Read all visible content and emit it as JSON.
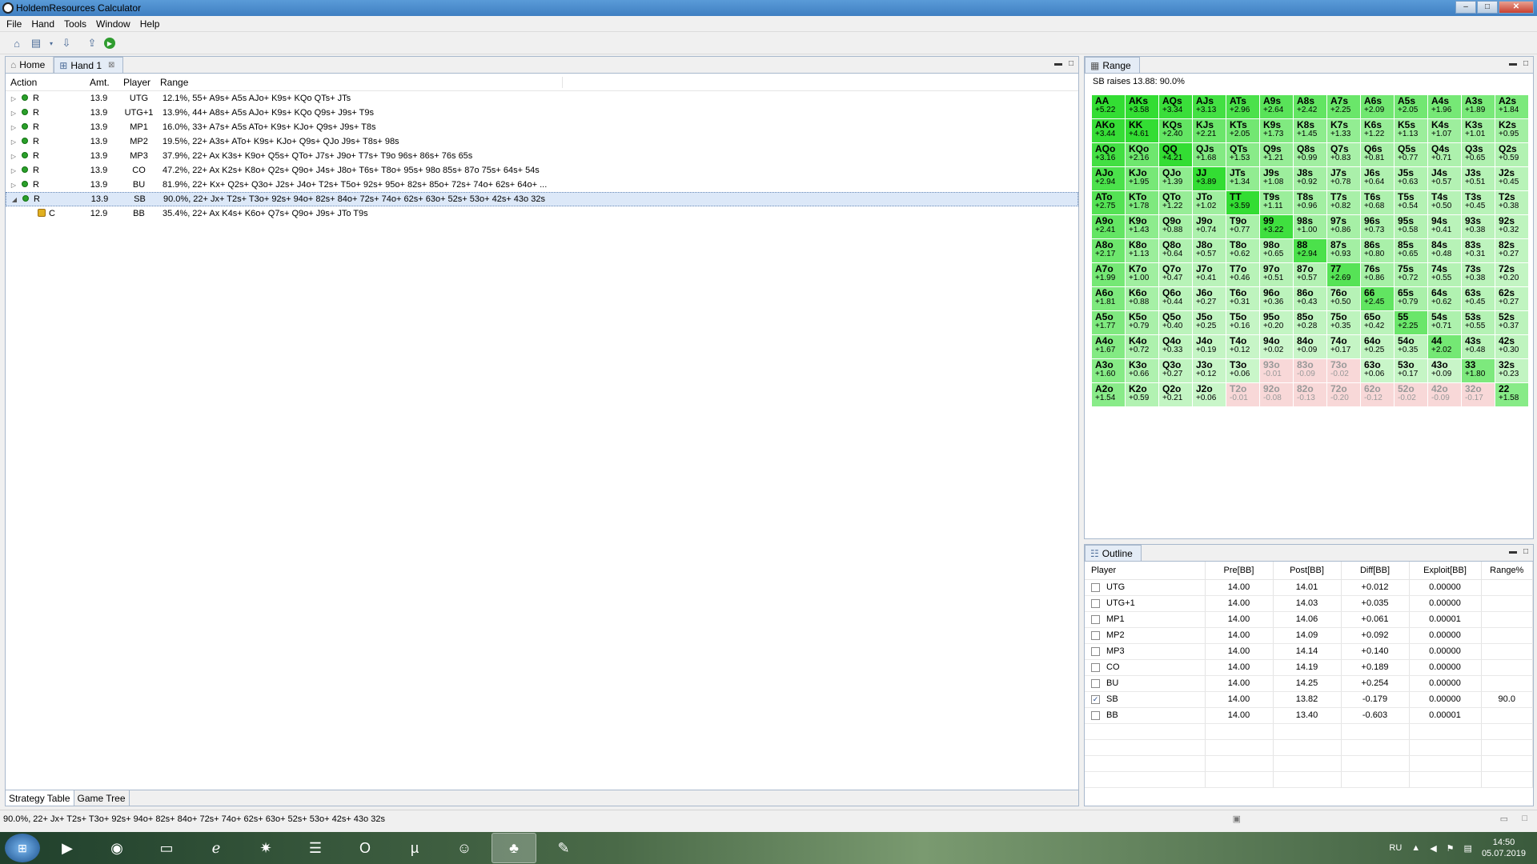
{
  "window": {
    "title": "HoldemResources Calculator"
  },
  "menu": [
    "File",
    "Hand",
    "Tools",
    "Window",
    "Help"
  ],
  "tabs": {
    "home": "Home",
    "hand": "Hand 1"
  },
  "strategy": {
    "headers": {
      "action": "Action",
      "amt": "Amt.",
      "player": "Player",
      "range": "Range"
    },
    "rows": [
      {
        "action": "R",
        "amt": "13.9",
        "player": "UTG",
        "range": "12.1%, 55+ A9s+ A5s AJo+ K9s+ KQo QTs+ JTs"
      },
      {
        "action": "R",
        "amt": "13.9",
        "player": "UTG+1",
        "range": "13.9%, 44+ A8s+ A5s AJo+ K9s+ KQo Q9s+ J9s+ T9s"
      },
      {
        "action": "R",
        "amt": "13.9",
        "player": "MP1",
        "range": "16.0%, 33+ A7s+ A5s ATo+ K9s+ KJo+ Q9s+ J9s+ T8s"
      },
      {
        "action": "R",
        "amt": "13.9",
        "player": "MP2",
        "range": "19.5%, 22+ A3s+ ATo+ K9s+ KJo+ Q9s+ QJo J9s+ T8s+ 98s"
      },
      {
        "action": "R",
        "amt": "13.9",
        "player": "MP3",
        "range": "37.9%, 22+ Ax K3s+ K9o+ Q5s+ QTo+ J7s+ J9o+ T7s+ T9o 96s+ 86s+ 76s 65s"
      },
      {
        "action": "R",
        "amt": "13.9",
        "player": "CO",
        "range": "47.2%, 22+ Ax K2s+ K8o+ Q2s+ Q9o+ J4s+ J8o+ T6s+ T8o+ 95s+ 98o 85s+ 87o 75s+ 64s+ 54s"
      },
      {
        "action": "R",
        "amt": "13.9",
        "player": "BU",
        "range": "81.9%, 22+ Kx+ Q2s+ Q3o+ J2s+ J4o+ T2s+ T5o+ 92s+ 95o+ 82s+ 85o+ 72s+ 74o+ 62s+ 64o+ ..."
      },
      {
        "action": "R",
        "amt": "13.9",
        "player": "SB",
        "range": "90.0%, 22+ Jx+ T2s+ T3o+ 92s+ 94o+ 82s+ 84o+ 72s+ 74o+ 62s+ 63o+ 52s+ 53o+ 42s+ 43o 32s"
      },
      {
        "action": "C",
        "amt": "12.9",
        "player": "BB",
        "range": "35.4%, 22+ Ax K4s+ K6o+ Q7s+ Q9o+ J9s+ JTo T9s"
      }
    ]
  },
  "bottom_tabs": [
    "Strategy Table",
    "Game Tree"
  ],
  "range_panel": {
    "title": "Range",
    "subtitle": "SB raises 13.88: 90.0%",
    "grid": [
      [
        "AA|+5.22",
        "AKs|+3.58",
        "AQs|+3.34",
        "AJs|+3.13",
        "ATs|+2.96",
        "A9s|+2.64",
        "A8s|+2.42",
        "A7s|+2.25",
        "A6s|+2.09",
        "A5s|+2.05",
        "A4s|+1.96",
        "A3s|+1.89",
        "A2s|+1.84"
      ],
      [
        "AKo|+3.44",
        "KK|+4.61",
        "KQs|+2.40",
        "KJs|+2.21",
        "KTs|+2.05",
        "K9s|+1.73",
        "K8s|+1.45",
        "K7s|+1.33",
        "K6s|+1.22",
        "K5s|+1.13",
        "K4s|+1.07",
        "K3s|+1.01",
        "K2s|+0.95"
      ],
      [
        "AQo|+3.16",
        "KQo|+2.16",
        "QQ|+4.21",
        "QJs|+1.68",
        "QTs|+1.53",
        "Q9s|+1.21",
        "Q8s|+0.99",
        "Q7s|+0.83",
        "Q6s|+0.81",
        "Q5s|+0.77",
        "Q4s|+0.71",
        "Q3s|+0.65",
        "Q2s|+0.59"
      ],
      [
        "AJo|+2.94",
        "KJo|+1.95",
        "QJo|+1.39",
        "JJ|+3.89",
        "JTs|+1.34",
        "J9s|+1.08",
        "J8s|+0.92",
        "J7s|+0.78",
        "J6s|+0.64",
        "J5s|+0.63",
        "J4s|+0.57",
        "J3s|+0.51",
        "J2s|+0.45"
      ],
      [
        "ATo|+2.75",
        "KTo|+1.78",
        "QTo|+1.22",
        "JTo|+1.02",
        "TT|+3.59",
        "T9s|+1.11",
        "T8s|+0.96",
        "T7s|+0.82",
        "T6s|+0.68",
        "T5s|+0.54",
        "T4s|+0.50",
        "T3s|+0.45",
        "T2s|+0.38"
      ],
      [
        "A9o|+2.41",
        "K9o|+1.43",
        "Q9o|+0.88",
        "J9o|+0.74",
        "T9o|+0.77",
        "99|+3.22",
        "98s|+1.00",
        "97s|+0.86",
        "96s|+0.73",
        "95s|+0.58",
        "94s|+0.41",
        "93s|+0.38",
        "92s|+0.32"
      ],
      [
        "A8o|+2.17",
        "K8o|+1.13",
        "Q8o|+0.64",
        "J8o|+0.57",
        "T8o|+0.62",
        "98o|+0.65",
        "88|+2.94",
        "87s|+0.93",
        "86s|+0.80",
        "85s|+0.65",
        "84s|+0.48",
        "83s|+0.31",
        "82s|+0.27"
      ],
      [
        "A7o|+1.99",
        "K7o|+1.00",
        "Q7o|+0.47",
        "J7o|+0.41",
        "T7o|+0.46",
        "97o|+0.51",
        "87o|+0.57",
        "77|+2.69",
        "76s|+0.86",
        "75s|+0.72",
        "74s|+0.55",
        "73s|+0.38",
        "72s|+0.20"
      ],
      [
        "A6o|+1.81",
        "K6o|+0.88",
        "Q6o|+0.44",
        "J6o|+0.27",
        "T6o|+0.31",
        "96o|+0.36",
        "86o|+0.43",
        "76o|+0.50",
        "66|+2.45",
        "65s|+0.79",
        "64s|+0.62",
        "63s|+0.45",
        "62s|+0.27"
      ],
      [
        "A5o|+1.77",
        "K5o|+0.79",
        "Q5o|+0.40",
        "J5o|+0.25",
        "T5o|+0.16",
        "95o|+0.20",
        "85o|+0.28",
        "75o|+0.35",
        "65o|+0.42",
        "55|+2.25",
        "54s|+0.71",
        "53s|+0.55",
        "52s|+0.37"
      ],
      [
        "A4o|+1.67",
        "K4o|+0.72",
        "Q4o|+0.33",
        "J4o|+0.19",
        "T4o|+0.12",
        "94o|+0.02",
        "84o|+0.09",
        "74o|+0.17",
        "64o|+0.25",
        "54o|+0.35",
        "44|+2.02",
        "43s|+0.48",
        "42s|+0.30"
      ],
      [
        "A3o|+1.60",
        "K3o|+0.66",
        "Q3o|+0.27",
        "J3o|+0.12",
        "T3o|+0.06",
        "93o|-0.01",
        "83o|-0.09",
        "73o|-0.02",
        "63o|+0.06",
        "53o|+0.17",
        "43o|+0.09",
        "33|+1.80",
        "32s|+0.23"
      ],
      [
        "A2o|+1.54",
        "K2o|+0.59",
        "Q2o|+0.21",
        "J2o|+0.06",
        "T2o|-0.01",
        "92o|-0.08",
        "82o|-0.13",
        "72o|-0.20",
        "62o|-0.12",
        "52o|-0.02",
        "42o|-0.09",
        "32o|-0.17",
        "22|+1.58"
      ]
    ]
  },
  "outline_panel": {
    "title": "Outline",
    "headers": [
      "Player",
      "Pre[BB]",
      "Post[BB]",
      "Diff[BB]",
      "Exploit[BB]",
      "Range%"
    ],
    "rows": [
      {
        "player": "UTG",
        "pre": "14.00",
        "post": "14.01",
        "diff": "+0.012",
        "exploit": "0.00000",
        "range": "",
        "checked": false
      },
      {
        "player": "UTG+1",
        "pre": "14.00",
        "post": "14.03",
        "diff": "+0.035",
        "exploit": "0.00000",
        "range": "",
        "checked": false
      },
      {
        "player": "MP1",
        "pre": "14.00",
        "post": "14.06",
        "diff": "+0.061",
        "exploit": "0.00001",
        "range": "",
        "checked": false
      },
      {
        "player": "MP2",
        "pre": "14.00",
        "post": "14.09",
        "diff": "+0.092",
        "exploit": "0.00000",
        "range": "",
        "checked": false
      },
      {
        "player": "MP3",
        "pre": "14.00",
        "post": "14.14",
        "diff": "+0.140",
        "exploit": "0.00000",
        "range": "",
        "checked": false
      },
      {
        "player": "CO",
        "pre": "14.00",
        "post": "14.19",
        "diff": "+0.189",
        "exploit": "0.00000",
        "range": "",
        "checked": false
      },
      {
        "player": "BU",
        "pre": "14.00",
        "post": "14.25",
        "diff": "+0.254",
        "exploit": "0.00000",
        "range": "",
        "checked": false
      },
      {
        "player": "SB",
        "pre": "14.00",
        "post": "13.82",
        "diff": "-0.179",
        "exploit": "0.00000",
        "range": "90.0",
        "checked": true
      },
      {
        "player": "BB",
        "pre": "14.00",
        "post": "13.40",
        "diff": "-0.603",
        "exploit": "0.00001",
        "range": "",
        "checked": false
      }
    ]
  },
  "status": {
    "text": "90.0%, 22+ Jx+ T2s+ T3o+ 92s+ 94o+ 82s+ 84o+ 72s+ 74o+ 62s+ 63o+ 52s+ 53o+ 42s+ 43o 32s"
  },
  "taskbar": {
    "lang": "RU",
    "time": "14:50",
    "date": "05.07.2019"
  },
  "colors": {
    "positive_strong": "#33dd33",
    "positive_light": "#ccf6cc",
    "negative": "#f8d8d8",
    "selection": "#dce8f8"
  }
}
